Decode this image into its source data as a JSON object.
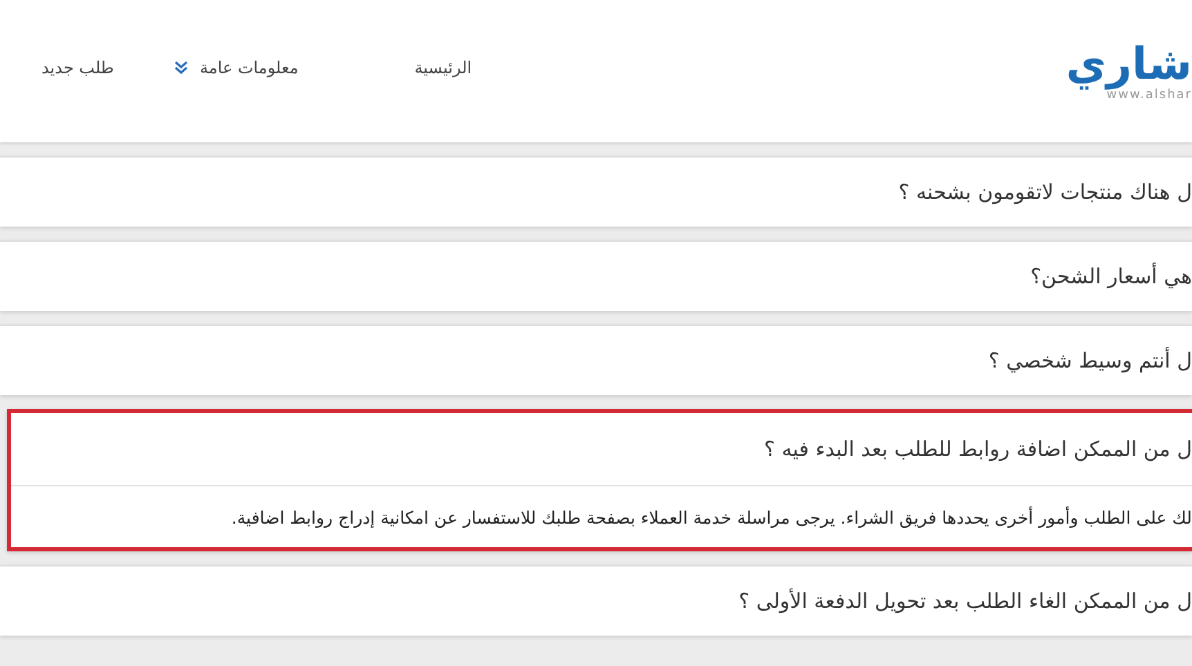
{
  "header": {
    "logo": {
      "name": "شاري",
      "url": "www.alshar"
    },
    "nav": [
      {
        "label": "الرئيسية",
        "kind": "link"
      },
      {
        "label": "معلومات عامة",
        "kind": "dropdown"
      },
      {
        "label": "طلب جديد",
        "kind": "link"
      }
    ]
  },
  "faq": [
    {
      "question": "ل هناك منتجات لاتقومون بشحنه ؟",
      "expanded": false
    },
    {
      "question": "هي أسعار الشحن؟",
      "expanded": false
    },
    {
      "question": "ل أنتم وسيط شخصي ؟",
      "expanded": false
    },
    {
      "question": "ل من الممكن اضافة روابط للطلب بعد البدء فيه ؟",
      "expanded": true,
      "answer": "لك على الطلب وأمور أخرى يحددها فريق الشراء. يرجى مراسلة خدمة العملاء بصفحة طلبك للاستفسار عن امكانية إدراج روابط اضافية."
    },
    {
      "question": "ل من الممكن الغاء الطلب بعد تحويل الدفعة الأولى ؟",
      "expanded": false
    }
  ]
}
